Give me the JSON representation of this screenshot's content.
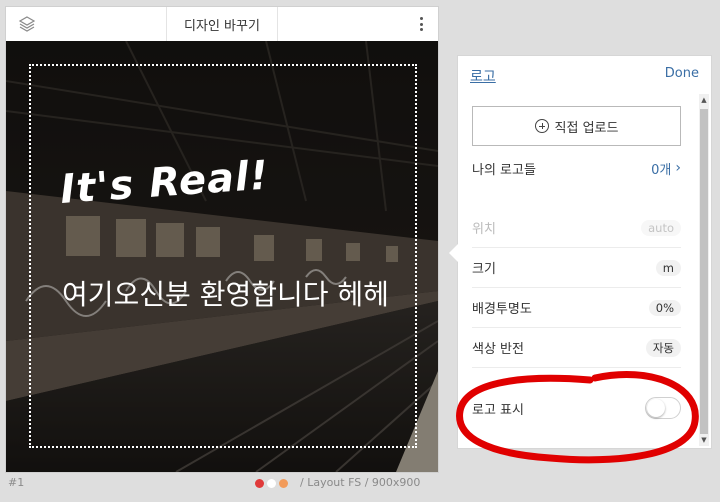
{
  "editor": {
    "title": "디자인 바꾸기",
    "headline": "It's Real!",
    "subtext": "여기오신분 환영합니다 헤헤"
  },
  "status": {
    "slide_number": "#1",
    "layout_label": "/  Layout FS  /  900x900",
    "dot_colors": [
      "#e03a3a",
      "#ffffff",
      "#f29b5a"
    ]
  },
  "panel": {
    "back_label": "로고",
    "done_label": "Done",
    "upload_label": "직접 업로드",
    "my_logos": {
      "label": "나의 로고들",
      "value": "0개"
    },
    "position": {
      "label": "위치",
      "value": "auto"
    },
    "size": {
      "label": "크기",
      "value": "m"
    },
    "bg_opacity": {
      "label": "배경투명도",
      "value": "0%"
    },
    "color_invert": {
      "label": "색상 반전",
      "value": "자동"
    },
    "show_logo": {
      "label": "로고 표시",
      "enabled": false
    }
  },
  "colors": {
    "accent": "#3a6ea5",
    "annotation": "#e00000"
  }
}
